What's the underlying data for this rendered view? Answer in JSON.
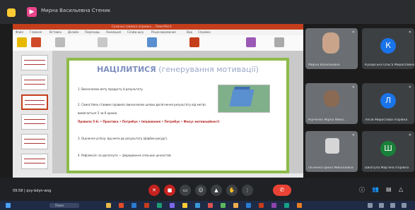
{
  "topbar": {
    "present_icon": "slideshow-icon",
    "title": "Мирна Васильевна Стеник"
  },
  "ppt": {
    "window_title": "Салонна гримаса опримка ... PowerPoint",
    "tabs": [
      "Файл",
      "Главная",
      "Вставка",
      "Дизайн",
      "Переходы",
      "Анимация",
      "Слайд-шоу",
      "Рецензирование",
      "Вид",
      "Справка"
    ],
    "slide": {
      "heading": "НАЦІЛИТИСЯ",
      "heading_rest": "(генерування мотивації)",
      "lines": [
        "1. Визначаємо мету продукту й результату.",
        "2. Самостійно ставимо правила (визначаємо шляхи досягнення результату від мети).",
        "вимагається 5 чи 6 кроків.",
        "Правила 5-6: • Практика • Потребує • Ініціювання • Потребує • Фокус мотиваційності",
        "3. Оцінення успіху: від мети до результату (фідбек-ресурс).",
        "4. Рефлексія: за досягнуте — формування спільних цінностей."
      ],
      "accent_color": "#8dbb4a"
    }
  },
  "participants": [
    {
      "name": "Мирна Васильевна",
      "type": "video",
      "icon": "mic-off-icon"
    },
    {
      "name": "Кухарська Ольга Мирославна",
      "initial": "К",
      "color": "#1a73e8",
      "icon": "mic-off-icon"
    },
    {
      "name": "Кірченко Мірна Мико...",
      "type": "video",
      "icon": "mic-off-icon"
    },
    {
      "name": "Лесів Мирослава Ігорівна",
      "initial": "Л",
      "color": "#1a73e8",
      "icon": "mic-off-icon"
    },
    {
      "name": "Ільченко Ірина Миколаївна",
      "type": "video",
      "icon": "mic-off-icon"
    },
    {
      "name": "Шкатула Мар'яна Ігорівна",
      "initial": "Ш",
      "color": "#188038",
      "icon": "mic-off-icon"
    }
  ],
  "meeting": {
    "time": "09:58",
    "code": "qvy-bdyn-wsg"
  },
  "controls": [
    "mic-off-icon",
    "camera-off-icon",
    "cc-icon",
    "emoji-icon",
    "present-icon",
    "raise-hand-icon",
    "more-icon"
  ],
  "taskbar": {
    "search": "Поиск"
  }
}
